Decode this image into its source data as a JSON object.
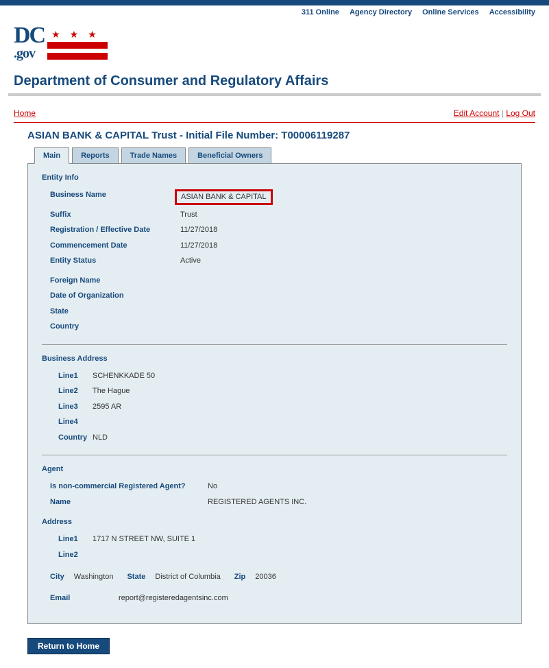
{
  "toplinks": {
    "l1": "311 Online",
    "l2": "Agency Directory",
    "l3": "Online Services",
    "l4": "Accessibility"
  },
  "logo": {
    "dc": "DC",
    "gov": ".gov"
  },
  "dept_title": "Department of Consumer and Regulatory Affairs",
  "nav": {
    "home": "Home",
    "edit_account": "Edit Account",
    "logout": "Log Out"
  },
  "entity_title": "ASIAN BANK & CAPITAL Trust - Initial File Number: T00006119287",
  "tabs": {
    "main": "Main",
    "reports": "Reports",
    "trade": "Trade Names",
    "owners": "Beneficial Owners"
  },
  "entity_info": {
    "heading": "Entity Info",
    "labels": {
      "business_name": "Business Name",
      "suffix": "Suffix",
      "reg_date": "Registration / Effective Date",
      "commencement": "Commencement Date",
      "status": "Entity Status",
      "foreign_name": "Foreign Name",
      "org_date": "Date of Organization",
      "state": "State",
      "country": "Country"
    },
    "values": {
      "business_name": "ASIAN BANK & CAPITAL",
      "suffix": "Trust",
      "reg_date": "11/27/2018",
      "commencement": "11/27/2018",
      "status": "Active",
      "foreign_name": "",
      "org_date": "",
      "state": "",
      "country": ""
    }
  },
  "business_address": {
    "heading": "Business Address",
    "labels": {
      "line1": "Line1",
      "line2": "Line2",
      "line3": "Line3",
      "line4": "Line4",
      "country": "Country"
    },
    "values": {
      "line1": "SCHENKKADE 50",
      "line2": "The Hague",
      "line3": "2595 AR",
      "line4": "",
      "country": "NLD"
    }
  },
  "agent": {
    "heading": "Agent",
    "labels": {
      "noncommercial": "Is non-commercial Registered Agent?",
      "name": "Name",
      "address": "Address",
      "line1": "Line1",
      "line2": "Line2",
      "city": "City",
      "state": "State",
      "zip": "Zip",
      "email": "Email"
    },
    "values": {
      "noncommercial": "No",
      "name": "REGISTERED AGENTS INC.",
      "line1": "1717 N STREET NW, SUITE 1",
      "line2": "",
      "city": "Washington",
      "state": "District of Columbia",
      "zip": "20036",
      "email": "report@registeredagentsinc.com"
    }
  },
  "return_button": "Return to Home"
}
